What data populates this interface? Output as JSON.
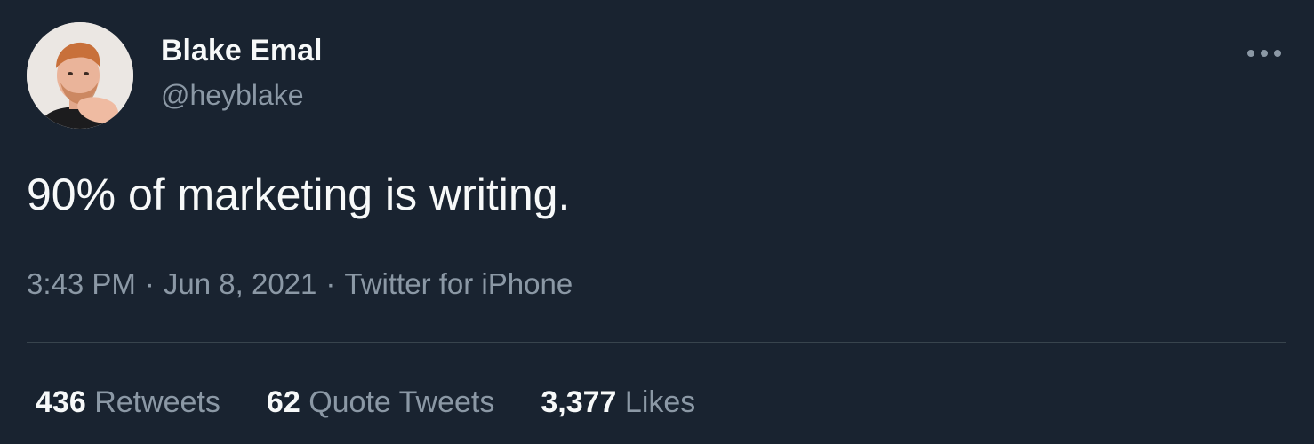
{
  "author": {
    "display_name": "Blake Emal",
    "handle": "@heyblake"
  },
  "more_icon": "more-horizontal-icon",
  "tweet": {
    "text": "90% of marketing is writing."
  },
  "meta": {
    "time": "3:43 PM",
    "separator": "·",
    "date": "Jun 8, 2021",
    "source": "Twitter for iPhone"
  },
  "stats": {
    "retweets_count": "436",
    "retweets_label": "Retweets",
    "quotes_count": "62",
    "quotes_label": "Quote Tweets",
    "likes_count": "3,377",
    "likes_label": "Likes"
  },
  "colors": {
    "background": "#192330",
    "primary_text": "#f7f9f9",
    "secondary_text": "#8b98a5",
    "divider": "#38444d"
  }
}
